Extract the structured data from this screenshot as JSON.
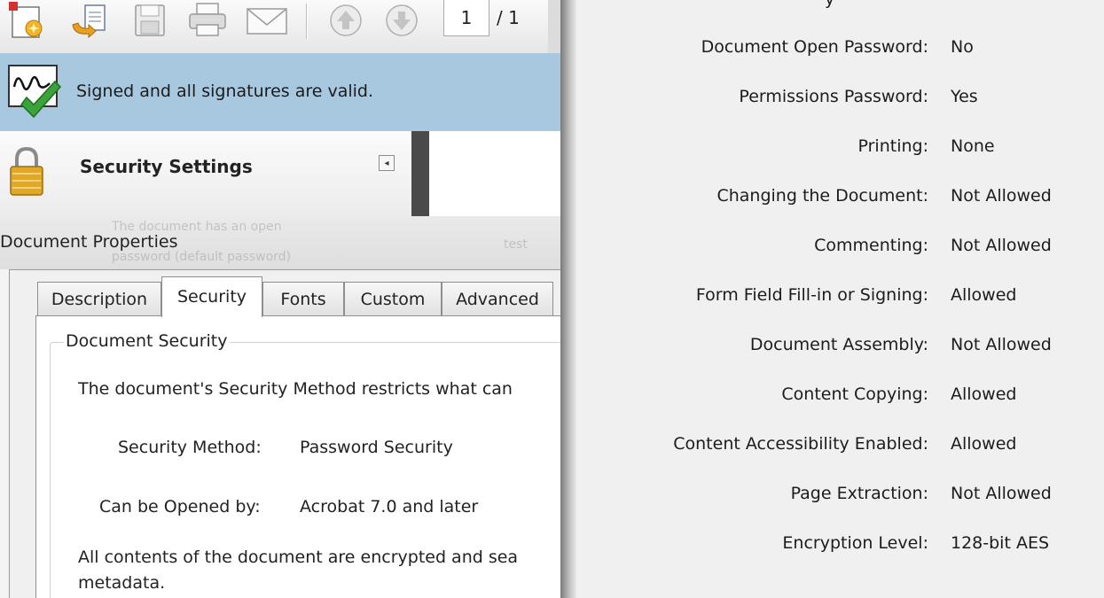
{
  "toolbar": {
    "icons": [
      "create-icon",
      "organize-icon",
      "save-icon",
      "print-icon",
      "email-icon",
      "previous-page-icon",
      "next-page-icon"
    ],
    "page_current": "1",
    "page_total": "/ 1"
  },
  "signature_bar": {
    "text": "Signed and all signatures are valid."
  },
  "security_panel": {
    "title": "Security Settings"
  },
  "properties_window": {
    "title": "Document Properties",
    "ghost_lines": [
      "The document has an open",
      "password (default password)",
      "test"
    ]
  },
  "dialog": {
    "tabs": [
      "Description",
      "Security",
      "Fonts",
      "Custom",
      "Advanced"
    ],
    "active_tab": "Security",
    "group_label": "Document Security",
    "intro_text": "The document's Security Method restricts what can",
    "method_label": "Security Method:",
    "method_value": "Password Security",
    "opened_label": "Can be Opened by:",
    "opened_value": "Acrobat 7.0 and later",
    "encrypt_line1": "All contents of the document are encrypted and sea",
    "encrypt_line2": "metadata."
  },
  "permissions": {
    "top_clipped": "y",
    "rows": [
      {
        "label": "Document Open Password:",
        "value": "No"
      },
      {
        "label": "Permissions Password:",
        "value": "Yes"
      },
      {
        "label": "Printing:",
        "value": "None"
      },
      {
        "label": "Changing the Document:",
        "value": "Not Allowed"
      },
      {
        "label": "Commenting:",
        "value": "Not Allowed"
      },
      {
        "label": "Form Field Fill-in or Signing:",
        "value": "Allowed"
      },
      {
        "label": "Document Assembly:",
        "value": "Not Allowed"
      },
      {
        "label": "Content Copying:",
        "value": "Allowed"
      },
      {
        "label": "Content Accessibility Enabled:",
        "value": "Allowed"
      },
      {
        "label": "Page Extraction:",
        "value": "Not Allowed"
      },
      {
        "label": "Encryption Level:",
        "value": "128-bit AES"
      }
    ]
  },
  "colors": {
    "signature_bar": "#a8c8e0",
    "check_green": "#3aa33a",
    "lock_gold": "#e0a826"
  }
}
